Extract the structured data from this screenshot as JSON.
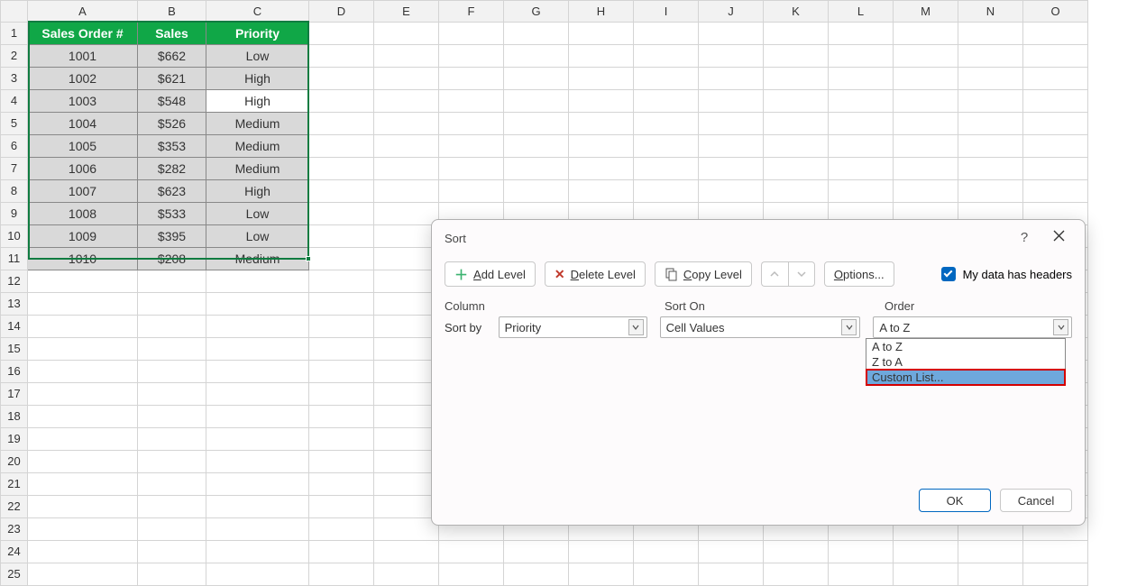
{
  "spreadsheet": {
    "columns": [
      "A",
      "B",
      "C",
      "D",
      "E",
      "F",
      "G",
      "H",
      "I",
      "J",
      "K",
      "L",
      "M",
      "N",
      "O"
    ],
    "headers": {
      "A": "Sales Order #",
      "B": "Sales",
      "C": "Priority"
    },
    "rows": [
      {
        "A": "1001",
        "B": "$662",
        "C": "Low"
      },
      {
        "A": "1002",
        "B": "$621",
        "C": "High"
      },
      {
        "A": "1003",
        "B": "$548",
        "C": "High"
      },
      {
        "A": "1004",
        "B": "$526",
        "C": "Medium"
      },
      {
        "A": "1005",
        "B": "$353",
        "C": "Medium"
      },
      {
        "A": "1006",
        "B": "$282",
        "C": "Medium"
      },
      {
        "A": "1007",
        "B": "$623",
        "C": "High"
      },
      {
        "A": "1008",
        "B": "$533",
        "C": "Low"
      },
      {
        "A": "1009",
        "B": "$395",
        "C": "Low"
      },
      {
        "A": "1010",
        "B": "$208",
        "C": "Medium"
      }
    ],
    "total_visible_rows": 25,
    "active_cell_white": {
      "row": 4,
      "col": "C"
    }
  },
  "dialog": {
    "title": "Sort",
    "help": "?",
    "toolbar": {
      "add_level": "Add Level",
      "delete_level": "Delete Level",
      "copy_level": "Copy Level",
      "options": "Options...",
      "headers_checkbox": "My data has headers"
    },
    "labels": {
      "column": "Column",
      "sort_on": "Sort On",
      "order": "Order",
      "sort_by": "Sort by"
    },
    "criteria": {
      "column_value": "Priority",
      "sort_on_value": "Cell Values",
      "order_value": "A to Z"
    },
    "dropdown_options": [
      "A to Z",
      "Z to A",
      "Custom List..."
    ],
    "highlighted_option": "Custom List...",
    "footer": {
      "ok": "OK",
      "cancel": "Cancel"
    }
  },
  "icons": {
    "chevron_down": "⌄",
    "chevron_up": "⌃"
  }
}
